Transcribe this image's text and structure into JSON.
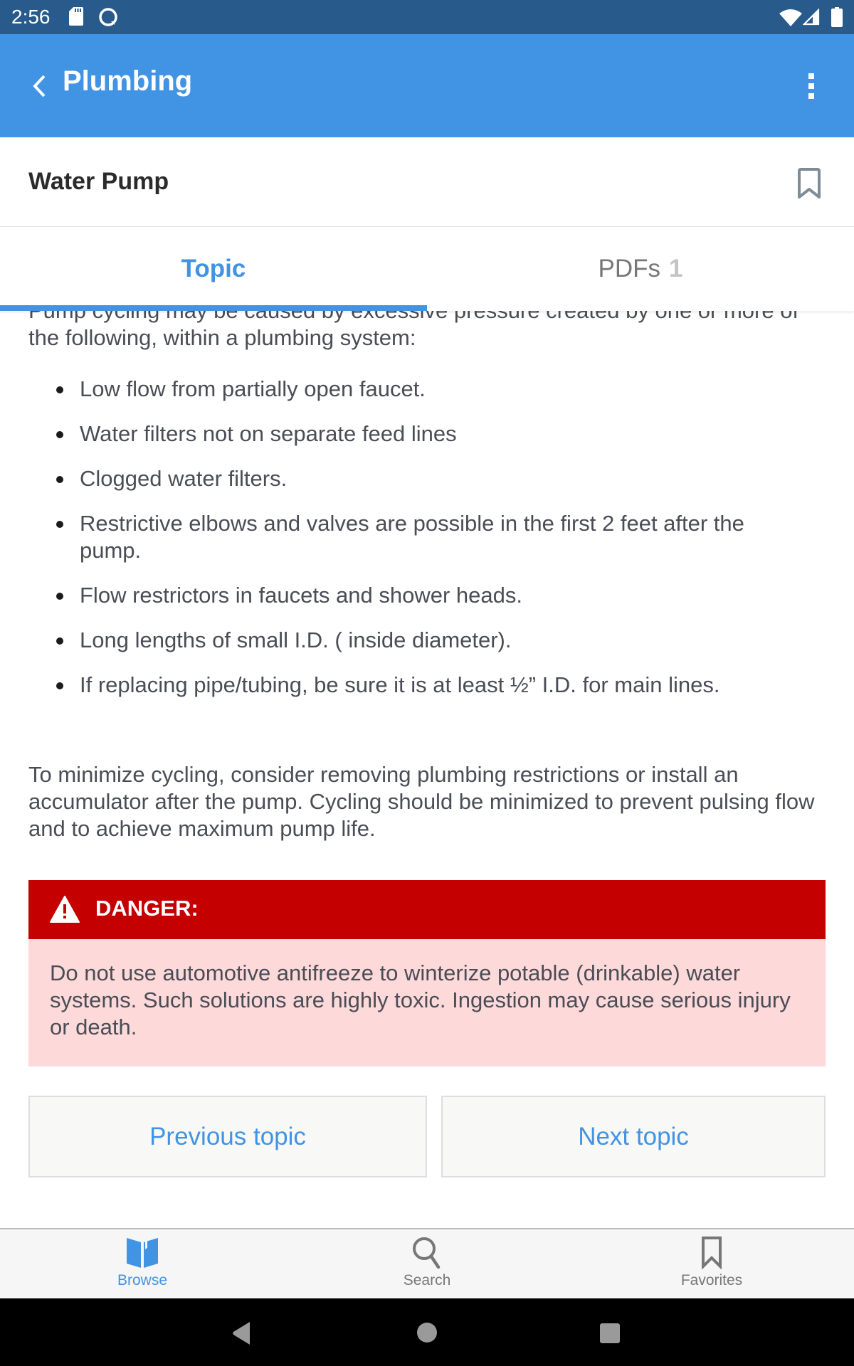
{
  "status_bar": {
    "time": "2:56",
    "icons": [
      "sd-card-icon",
      "sync-icon",
      "wifi-icon",
      "signal-icon",
      "battery-icon"
    ]
  },
  "app_bar": {
    "title": "Plumbing",
    "back_icon": "chevron-left-icon",
    "menu_icon": "more-vert-icon",
    "color": "#4193e3"
  },
  "topic": {
    "title": "Water Pump",
    "bookmark_icon": "bookmark-outline-icon"
  },
  "tabs": [
    {
      "label": "Topic",
      "active": true
    },
    {
      "label": "PDFs",
      "count": "1",
      "active": false
    }
  ],
  "content": {
    "intro": "Pump cycling may be caused by excessive pressure created by one or more of the following, within a plumbing system:",
    "causes": [
      "Low flow from partially open faucet.",
      "Water filters not on separate feed lines",
      "Clogged water filters.",
      "Restrictive elbows and valves are possible in the first 2 feet after the pump.",
      "Flow restrictors in faucets and shower heads.",
      "Long lengths of small I.D. ( inside diameter).",
      "If replacing pipe/tubing, be sure it is at least ½” I.D. for main lines."
    ],
    "summary": "To minimize cycling, consider removing plumbing restrictions or install an accumulator after the pump. Cycling should be minimized to prevent pulsing flow and to achieve maximum pump life.",
    "danger": {
      "label": "DANGER:",
      "icon": "warning-triangle-icon",
      "text": "Do not use automotive antifreeze to winterize potable (drinkable) water systems. Such solutions are highly toxic. Ingestion may cause serious injury or death.",
      "header_color": "#c40000",
      "body_color": "#fdd9da"
    }
  },
  "navigation": {
    "previous_label": "Previous topic",
    "next_label": "Next topic"
  },
  "bottom_nav": [
    {
      "label": "Browse",
      "icon": "book-icon",
      "active": true
    },
    {
      "label": "Search",
      "icon": "search-icon",
      "active": false
    },
    {
      "label": "Favorites",
      "icon": "bookmark-icon",
      "active": false
    }
  ]
}
